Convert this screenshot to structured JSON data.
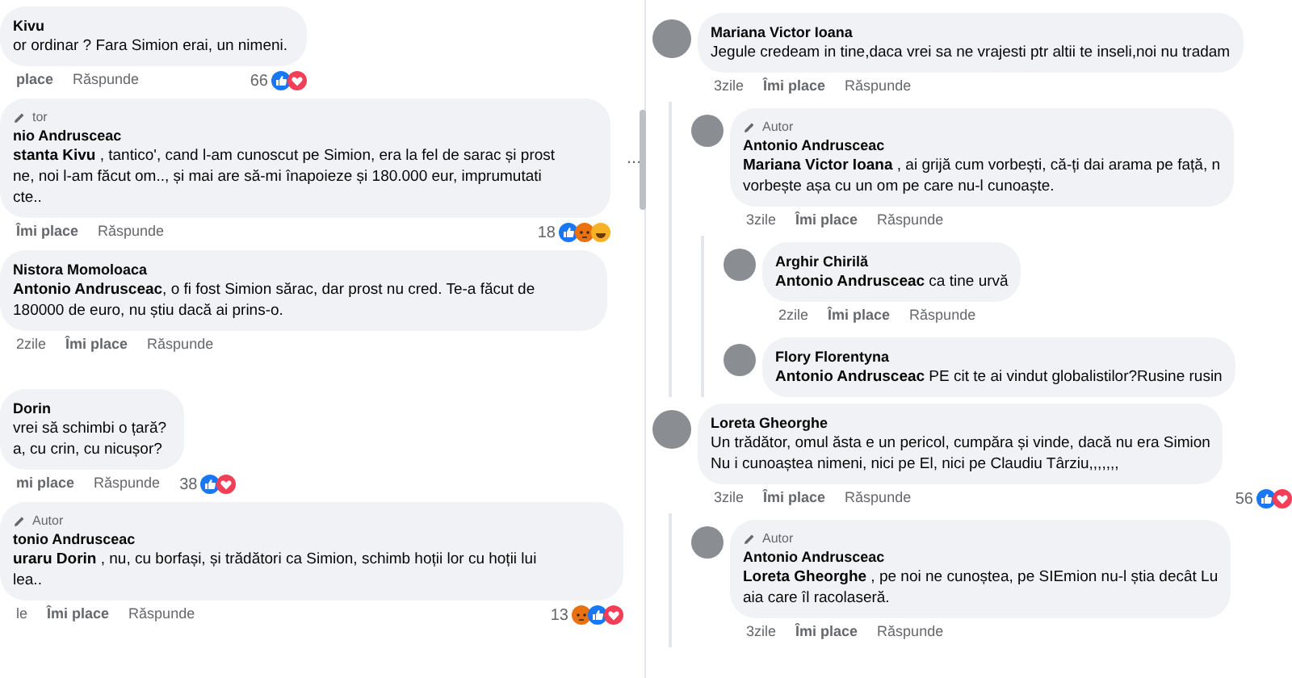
{
  "left_panel": {
    "comments": [
      {
        "name": "Kivu",
        "lines": [
          "or ordinar ? Fara Simion erai, un nimeni."
        ],
        "like_label": "place",
        "reply_label": "Răspunde",
        "count": "66",
        "reactions": [
          {
            "kind": "like"
          },
          {
            "kind": "love"
          }
        ]
      },
      {
        "author_label": "tor",
        "name": "nio Andrusceac",
        "lines": [
          "**stanta Kivu** , tantico', cand l-am cunoscut pe Simion, era la fel de sarac și prost",
          "ne, noi l-am făcut om.., și mai are să-mi înapoieze și 180.000 eur, imprumutati",
          "cte.."
        ],
        "like_label": "Îmi place",
        "reply_label": "Răspunde",
        "count": "18",
        "reactions": [
          {
            "kind": "like"
          },
          {
            "kind": "angry"
          },
          {
            "kind": "haha"
          }
        ],
        "more": "..."
      },
      {
        "name": "Nistora Momoloaca",
        "lines": [
          "**Antonio Andrusceac**, o fi fost Simion sărac, dar prost nu cred. Te-a făcut de",
          "180000 de euro, nu știu dacă ai prins-o."
        ],
        "time": "2zile",
        "like_label": "Îmi place",
        "reply_label": "Răspunde"
      },
      {
        "name": "Dorin",
        "lines": [
          "vrei să schimbi o țară?",
          "a, cu crin, cu nicușor?"
        ],
        "like_label": "mi place",
        "reply_label": "Răspunde",
        "count": "38",
        "reactions": [
          {
            "kind": "like"
          },
          {
            "kind": "love"
          }
        ]
      },
      {
        "author_label": "Autor",
        "name": "tonio Andrusceac",
        "lines": [
          "**uraru Dorin** , nu, cu borfași, și trădători ca Simion, schimb hoții lor cu hoții lui",
          "lea.."
        ],
        "time": "le",
        "like_label": "Îmi place",
        "reply_label": "Răspunde",
        "count": "13",
        "reactions": [
          {
            "kind": "angry"
          },
          {
            "kind": "like"
          },
          {
            "kind": "love"
          }
        ]
      }
    ]
  },
  "right_panel": {
    "comments": [
      {
        "name": "Mariana Victor Ioana",
        "lines": [
          "Jegule credeam in tine,daca vrei sa ne vrajesti ptr altii te inseli,noi nu tradam"
        ],
        "time": "3zile",
        "like_label": "Îmi place",
        "reply_label": "Răspunde",
        "children": [
          {
            "author_label": "Autor",
            "name": "Antonio Andrusceac",
            "lines": [
              "**Mariana Victor Ioana** , ai grijă cum vorbești, că-ți dai arama pe față, n",
              "vorbește așa cu un om pe care nu-l cunoaște."
            ],
            "time": "3zile",
            "like_label": "Îmi place",
            "reply_label": "Răspunde",
            "children": [
              {
                "name": "Arghir Chirilă",
                "lines": [
                  "**Antonio Andrusceac** ca tine urvă"
                ],
                "time": "2zile",
                "like_label": "Îmi place",
                "reply_label": "Răspunde"
              },
              {
                "name": "Flory Florentyna",
                "lines": [
                  "**Antonio Andrusceac** PE cit te ai vindut globalistilor?Rusine rusin"
                ]
              }
            ]
          }
        ]
      },
      {
        "name": "Loreta Gheorghe",
        "lines": [
          "Un trădător, omul ăsta e un pericol, cumpăra și vinde, dacă nu era Simion",
          "Nu i cunoaștea nimeni, nici pe El, nici pe Claudiu Târziu,,,,,,,"
        ],
        "time": "3zile",
        "like_label": "Îmi place",
        "reply_label": "Răspunde",
        "count": "56",
        "reactions": [
          {
            "kind": "like"
          },
          {
            "kind": "love"
          }
        ],
        "children": [
          {
            "author_label": "Autor",
            "name": "Antonio Andrusceac",
            "lines": [
              "**Loreta Gheorghe** , pe noi ne cunoștea, pe SIEmion nu-l știa decât Lu",
              "aia care îl racolaseră."
            ],
            "time": "3zile",
            "like_label": "Îmi place",
            "reply_label": "Răspunde"
          }
        ]
      }
    ]
  }
}
